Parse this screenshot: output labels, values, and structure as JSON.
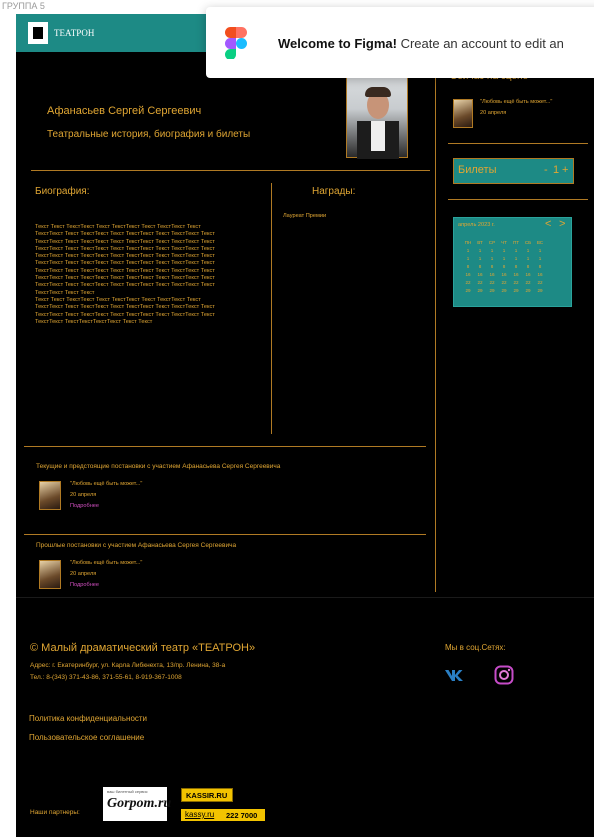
{
  "frame_label": "ГРУППА 5",
  "header": {
    "brand": "ТЕАТРОН"
  },
  "toast": {
    "bold": "Welcome to Figma!",
    "text": " Create an account to edit an"
  },
  "actor": {
    "name": "Афанасьев Сергей Сергеевич",
    "subtitle": "Театральные история, биография и билеты"
  },
  "bio": {
    "heading": "Биография:",
    "lines": [
      "Текст Текст ТекстТекст Текст ТекстТекст Текст ТекстТекст Текст",
      "ТекстТекст Текст ТекстТекст Текст ТекстТекст Текст ТекстТекст Текст",
      "ТекстТекст Текст ТекстТекст Текст ТекстТекст Текст ТекстТекст Текст",
      "ТекстТекст Текст ТекстТекст Текст ТекстТекст Текст ТекстТекст Текст",
      "ТекстТекст Текст ТекстТекст Текст ТекстТекст Текст ТекстТекст Текст",
      "ТекстТекст Текст ТекстТекст Текст ТекстТекст Текст ТекстТекст Текст",
      "ТекстТекст Текст ТекстТекст Текст ТекстТекст Текст ТекстТекст Текст",
      "ТекстТекст Текст ТекстТекст Текст ТекстТекст Текст ТекстТекст Текст",
      "ТекстТекст Текст ТекстТекст Текст ТекстТекст Текст ТекстТекст Текст",
      "ТекстТекст Текст Текст",
      "Текст Текст ТекстТекст Текст ТекстТекст Текст ТекстТекст Текст",
      "ТекстТекст Текст ТекстТекст Текст ТекстТекст Текст ТекстТекст Текст",
      "ТекстТекст Текст ТекстТекст Текст ТекстТекст Текст ТекстТекст Текст",
      "ТекстТекст ТекстТекстТекстТекст Текст Текст"
    ]
  },
  "awards": {
    "heading": "Награды:",
    "item": "Лауреат Премии"
  },
  "now_on_stage": {
    "heading": "Сейчас на сцене",
    "title": "\"Любовь ещё быть может...\"",
    "date": "20 апреля"
  },
  "tickets": {
    "label": "Билеты",
    "minus": "-",
    "count": "1",
    "plus": "+"
  },
  "calendar": {
    "month": "апрель 2023 г.",
    "prev": "<",
    "next": ">",
    "weekdays": [
      "ПН",
      "ВТ",
      "СР",
      "ЧТ",
      "ПТ",
      "СБ",
      "ВС"
    ],
    "rows": [
      [
        "1",
        "1",
        "1",
        "1",
        "1",
        "1",
        "1"
      ],
      [
        "1",
        "1",
        "1",
        "1",
        "1",
        "1",
        "1"
      ],
      [
        "8",
        "8",
        "8",
        "8",
        "8",
        "8",
        "8"
      ],
      [
        "16",
        "16",
        "16",
        "16",
        "16",
        "16",
        "16"
      ],
      [
        "22",
        "22",
        "22",
        "22",
        "22",
        "22",
        "22"
      ],
      [
        "29",
        "29",
        "29",
        "29",
        "29",
        "29",
        "29"
      ]
    ]
  },
  "current": {
    "heading": "Текущие и предстоящие постановки с участием Афанасьева Сергея Сергеевича",
    "title": "\"Любовь ещё быть может...\"",
    "date": "20 апреля",
    "more": "Подробнее"
  },
  "past": {
    "heading": "Прошлые постановки с участием Афанасьева Сергея Сергеевича",
    "title": "\"Любовь ещё быть может...\"",
    "date": "20 апреля",
    "more": "Подробнее"
  },
  "footer": {
    "copyright": "© Малый драматический театр «ТЕАТРОН»",
    "address": "Адрес: г. Екатеринбург, ул. Карла Либкнехта, 13/пр. Ленина, 38-а",
    "phone": "Тел.: 8-(343) 371-43-86, 371-55-61, 8-919-367-1008",
    "privacy": "Политика конфиденциальности",
    "agreement": "Пользовательское соглашение",
    "social_heading": "Мы в соц.Сетях:",
    "partners_label": "Наши партнеры:",
    "partner1": "Gorpom.ru",
    "partner1_top": "ваш билетный сервис",
    "partner2": "KASSIR.RU",
    "partner3": "kassy.ru",
    "partner3_num": "222 7000"
  },
  "colors": {
    "accent": "#e0a633",
    "teal": "#1d8a85",
    "link": "#d04fbf",
    "bg": "#000000"
  }
}
